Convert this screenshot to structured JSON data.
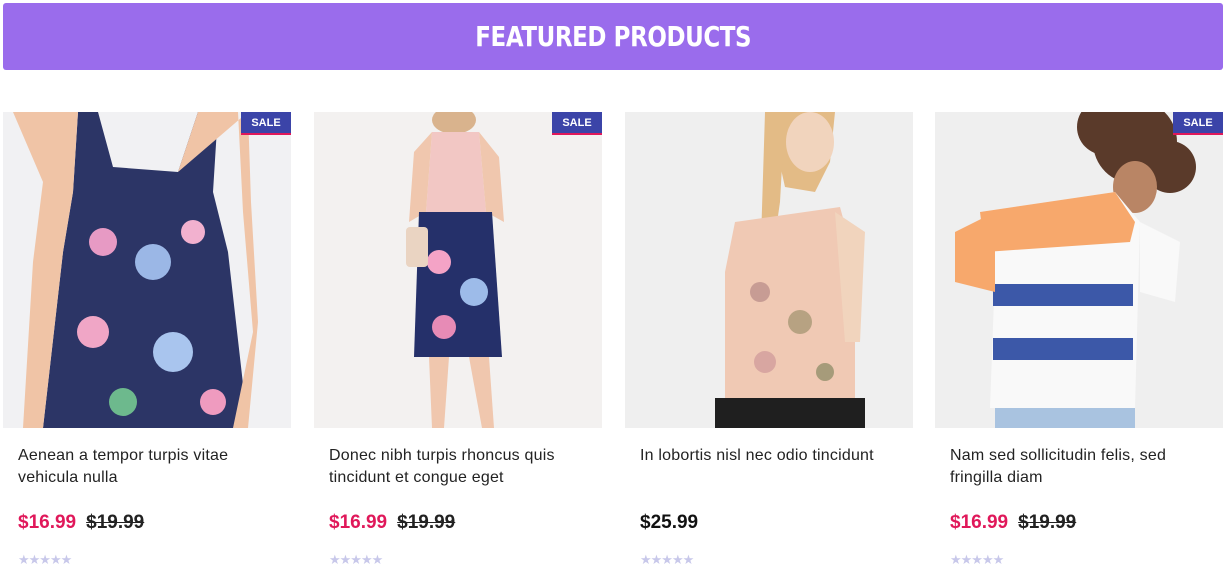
{
  "section": {
    "title": "FEATURED PRODUCTS"
  },
  "colors": {
    "banner": "#9a6cec",
    "sale_badge": "#3b44a8",
    "sale_price": "#e0185a",
    "stars": "#c8c8ea"
  },
  "products": [
    {
      "badge": "SALE",
      "title": "Aenean a tempor turpis vitae vehicula nulla",
      "price": "$16.99",
      "old_price": "$19.99",
      "rating": "★★★★★",
      "image_icon": "floral-dress-photo"
    },
    {
      "badge": "SALE",
      "title": "Donec nibh turpis rhoncus quis tincidunt et congue eget",
      "price": "$16.99",
      "old_price": "$19.99",
      "rating": "★★★★★",
      "image_icon": "floral-skirt-photo"
    },
    {
      "badge": "",
      "title": "In lobortis nisl nec odio tincidunt",
      "price": "$25.99",
      "old_price": "",
      "rating": "★★★★★",
      "image_icon": "ruffle-top-photo"
    },
    {
      "badge": "SALE",
      "title": "Nam sed sollicitudin felis, sed fringilla diam",
      "price": "$16.99",
      "old_price": "$19.99",
      "rating": "★★★★★",
      "image_icon": "striped-tshirt-photo"
    }
  ]
}
